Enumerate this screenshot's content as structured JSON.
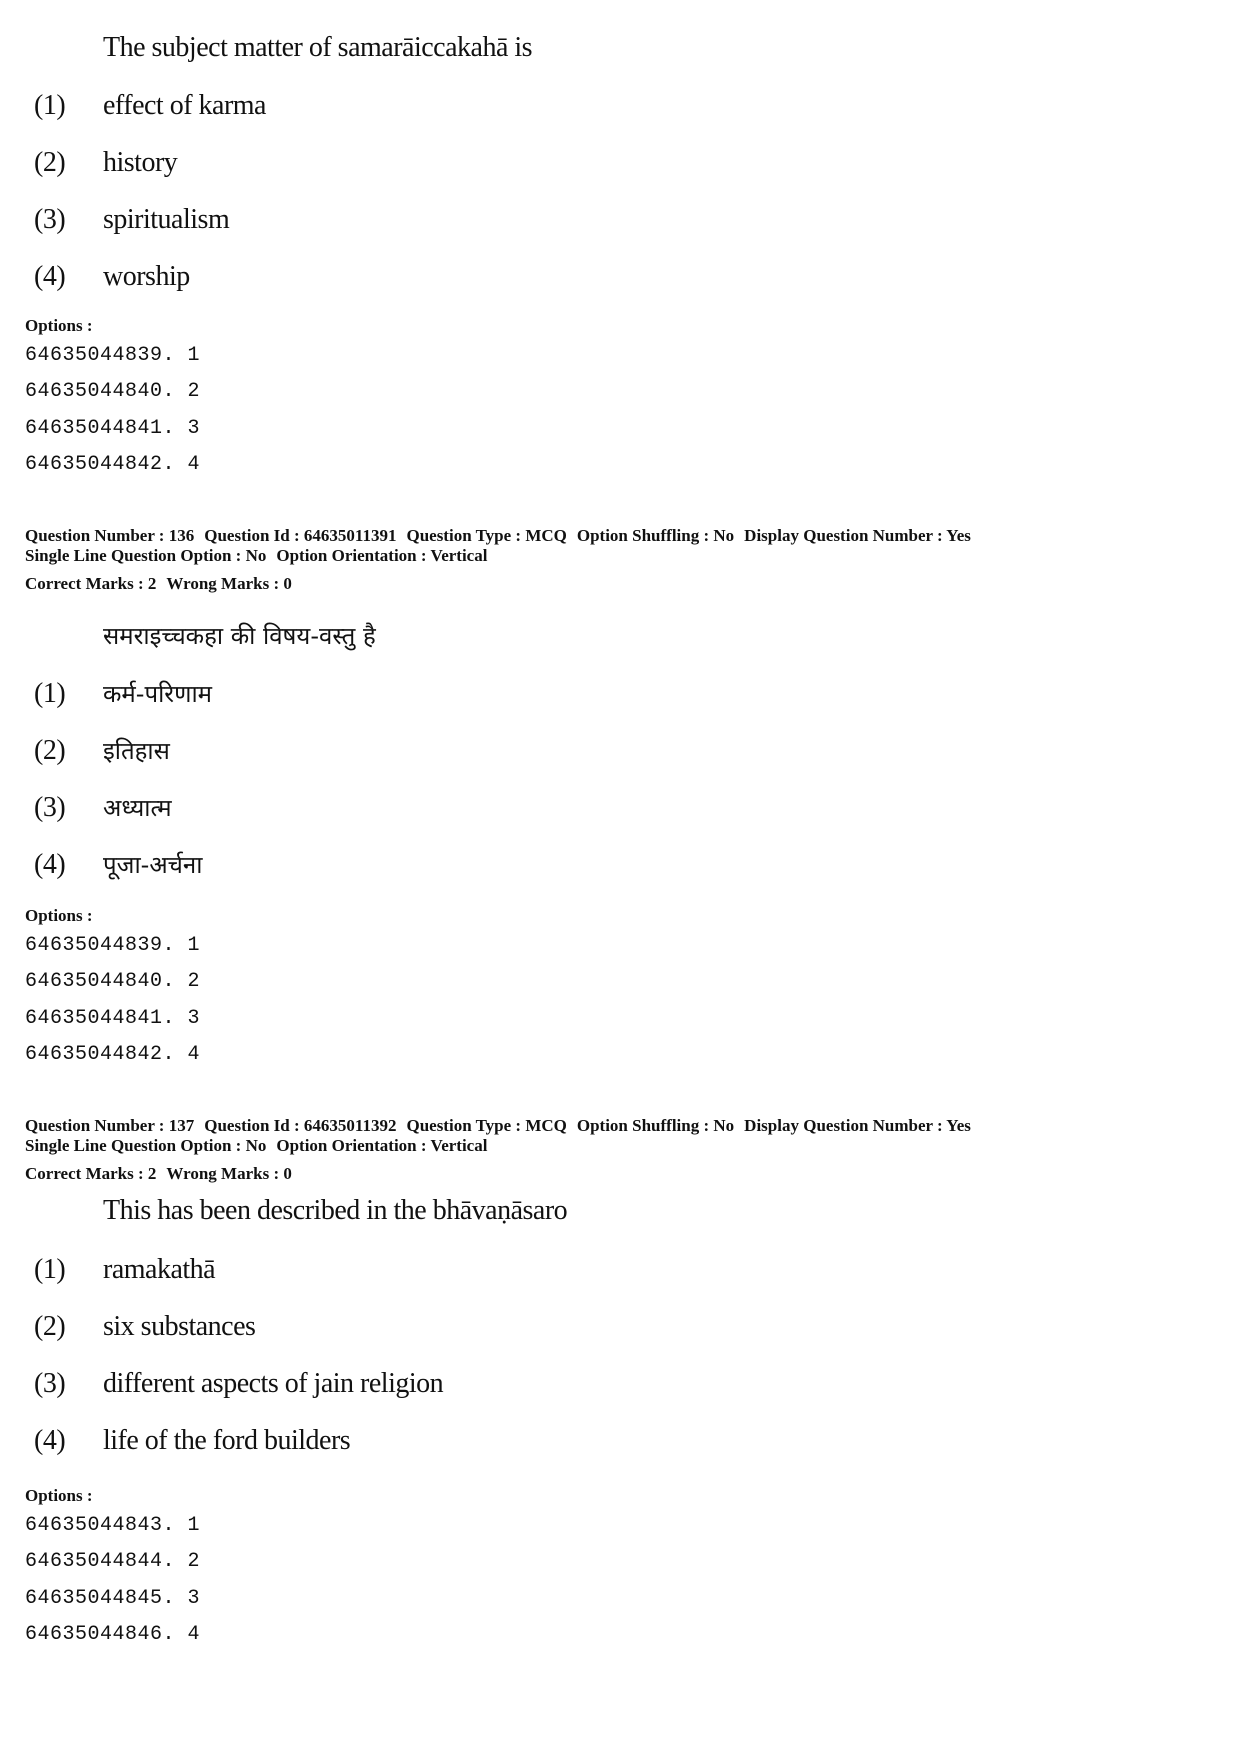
{
  "questions": [
    {
      "stem": "The subject matter of samarāiccakahā is",
      "choices": [
        {
          "num": "(1)",
          "text": "effect of karma"
        },
        {
          "num": "(2)",
          "text": "history"
        },
        {
          "num": "(3)",
          "text": "spiritualism"
        },
        {
          "num": "(4)",
          "text": "worship"
        }
      ],
      "options_label": "Options :",
      "option_ids": [
        "64635044839. 1",
        "64635044840. 2",
        "64635044841. 3",
        "64635044842. 4"
      ]
    },
    {
      "meta": {
        "line1": [
          "Question Number : 136",
          "Question Id : 64635011391",
          "Question Type : MCQ",
          "Option Shuffling : No",
          "Display Question Number : Yes"
        ],
        "line2": [
          "Single Line Question Option : No",
          "Option Orientation : Vertical"
        ],
        "line3": [
          "Correct Marks : 2",
          "Wrong Marks : 0"
        ]
      },
      "stem": "समराइच्चकहा की विषय-वस्तु है",
      "choices": [
        {
          "num": "(1)",
          "text": "कर्म-परिणाम"
        },
        {
          "num": "(2)",
          "text": "इतिहास"
        },
        {
          "num": "(3)",
          "text": "अध्यात्म"
        },
        {
          "num": "(4)",
          "text": "पूजा-अर्चना"
        }
      ],
      "options_label": "Options :",
      "option_ids": [
        "64635044839. 1",
        "64635044840. 2",
        "64635044841. 3",
        "64635044842. 4"
      ]
    },
    {
      "meta": {
        "line1": [
          "Question Number : 137",
          "Question Id : 64635011392",
          "Question Type : MCQ",
          "Option Shuffling : No",
          "Display Question Number : Yes"
        ],
        "line2": [
          "Single Line Question Option : No",
          "Option Orientation : Vertical"
        ],
        "line3": [
          "Correct Marks : 2",
          "Wrong Marks : 0"
        ]
      },
      "stem": "This has been described in the bhāvaṇāsaro",
      "choices": [
        {
          "num": "(1)",
          "text": "ramakathā"
        },
        {
          "num": "(2)",
          "text": "six substances"
        },
        {
          "num": "(3)",
          "text": "different aspects of jain religion"
        },
        {
          "num": "(4)",
          "text": "life of the ford builders"
        }
      ],
      "options_label": "Options :",
      "option_ids": [
        "64635044843. 1",
        "64635044844. 2",
        "64635044845. 3",
        "64635044846. 4"
      ]
    }
  ]
}
